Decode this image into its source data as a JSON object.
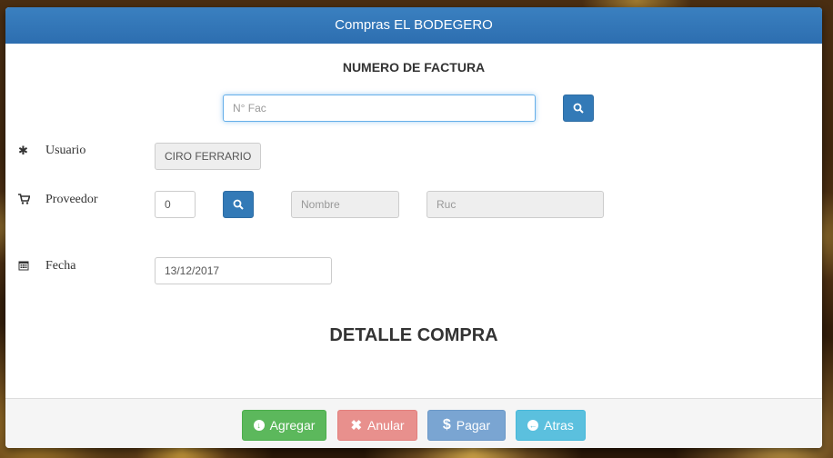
{
  "modal": {
    "title": "Compras EL BODEGERO"
  },
  "factura": {
    "heading": "NUMERO DE FACTURA",
    "placeholder": "N° Fac"
  },
  "usuario": {
    "label": "Usuario",
    "value": "CIRO FERRARIO",
    "icon": "asterisk-icon"
  },
  "proveedor": {
    "label": "Proveedor",
    "code_value": "0",
    "nombre_placeholder": "Nombre",
    "ruc_placeholder": "Ruc",
    "icon": "shopping-cart-icon"
  },
  "fecha": {
    "label": "Fecha",
    "value": "13/12/2017",
    "icon": "calendar-icon"
  },
  "detalle": {
    "title": "DETALLE COMPRA"
  },
  "footer": {
    "agregar": "Agregar",
    "anular": "Anular",
    "pagar": "Pagar",
    "atras": "Atras"
  },
  "colors": {
    "header": "#337ab7",
    "success": "#5cb85c",
    "danger": "#e8908d",
    "primary_light": "#7aa5d2",
    "info": "#5bc0de"
  }
}
